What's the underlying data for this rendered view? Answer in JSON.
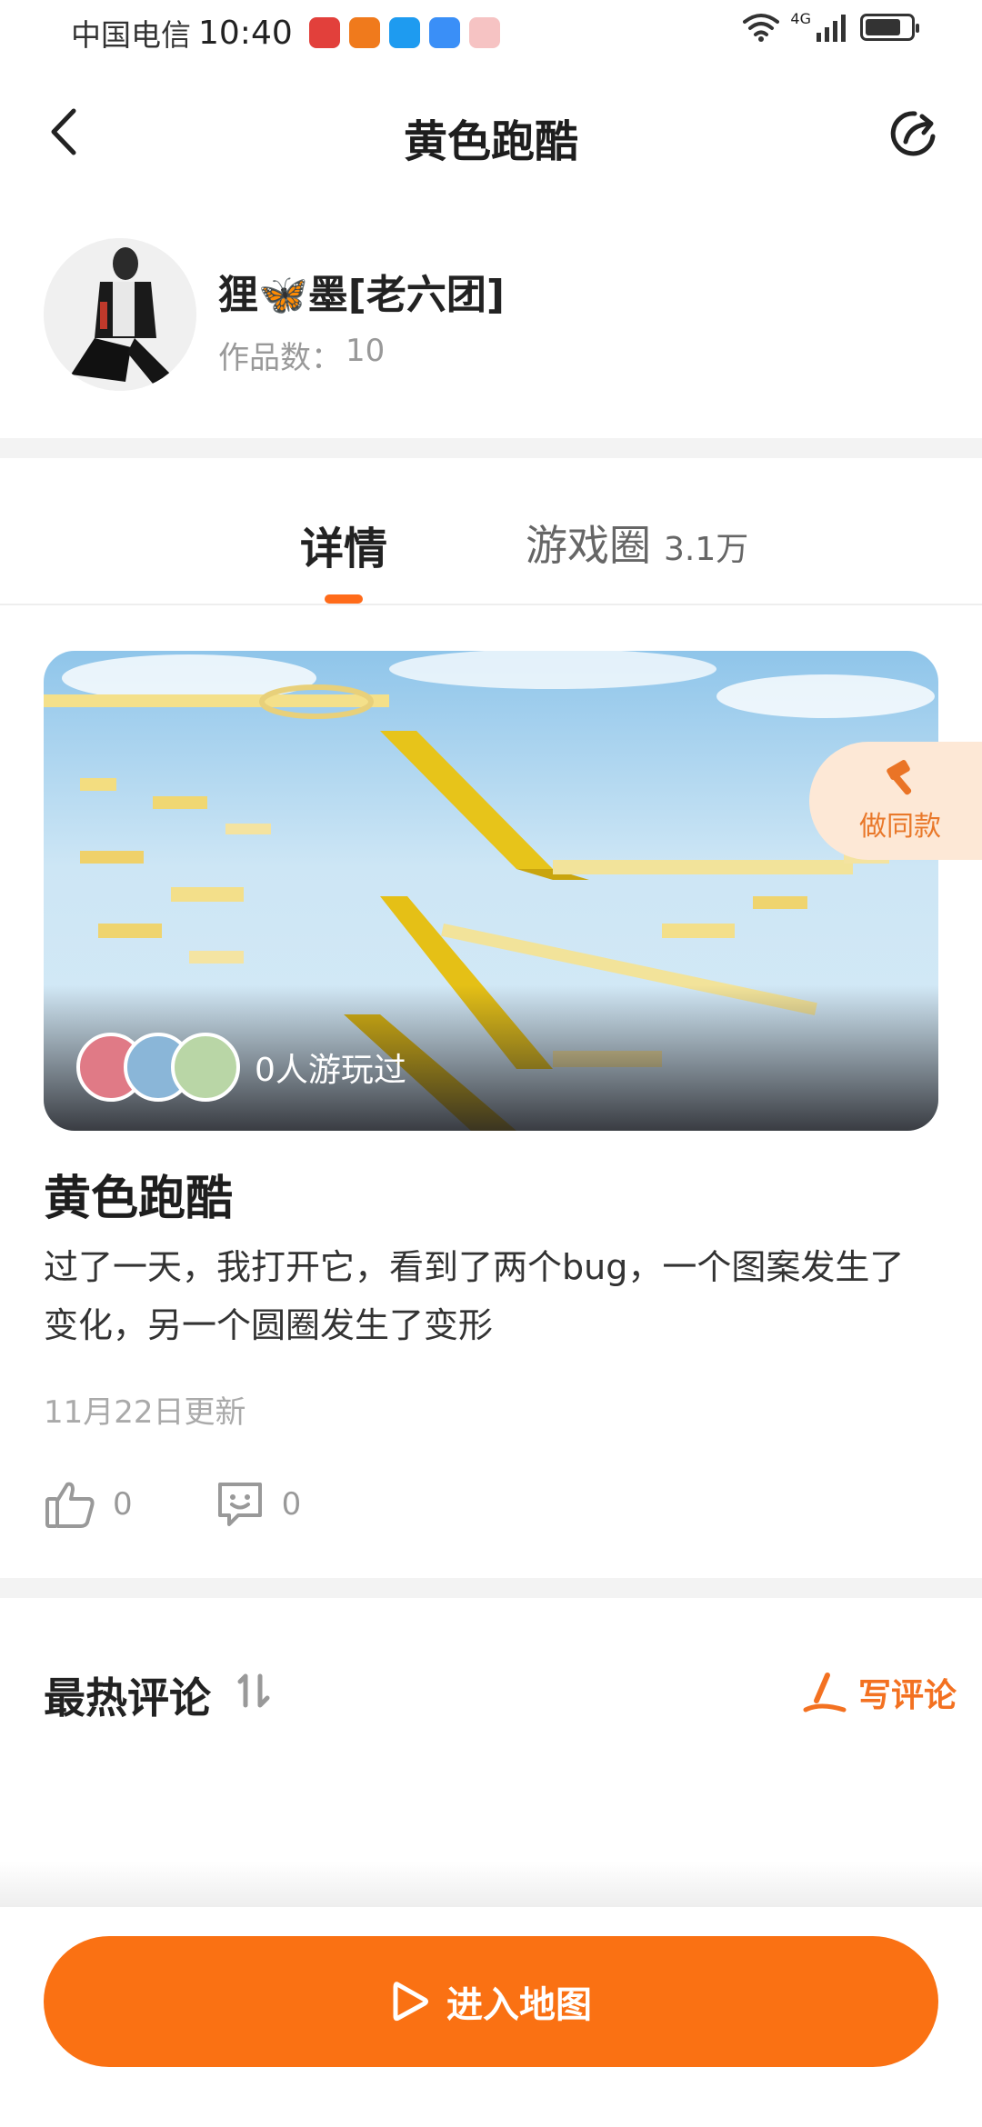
{
  "status_bar": {
    "carrier": "中国电信",
    "time": "10:40",
    "network": "4G",
    "battery_level": 0.8,
    "app_icons": [
      "book-app-icon",
      "download-app-icon",
      "browser-app-icon",
      "weather-app-icon",
      "notification-app-icon"
    ]
  },
  "header": {
    "title": "黄色跑酷"
  },
  "author": {
    "name": "狸🦋墨[老六团]",
    "works_label": "作品数：",
    "works_count": "10"
  },
  "tabs": {
    "detail": "详情",
    "circle": "游戏圈",
    "circle_count": "3.1万"
  },
  "banner": {
    "players_text": "0人游玩过"
  },
  "make_same": {
    "label": "做同款"
  },
  "game": {
    "title": "黄色跑酷",
    "description": "过了一天，我打开它，看到了两个bug，一个图案发生了变化，另一个圆圈发生了变形",
    "updated": "11月22日更新",
    "likes": "0",
    "comments": "0"
  },
  "comments": {
    "title": "最热评论",
    "write_label": "写评论"
  },
  "bottom": {
    "enter_label": "进入地图"
  },
  "colors": {
    "accent": "#fa7113",
    "make_same_bg": "#fde8d6",
    "tab_indicator": "#ff6b1a"
  }
}
